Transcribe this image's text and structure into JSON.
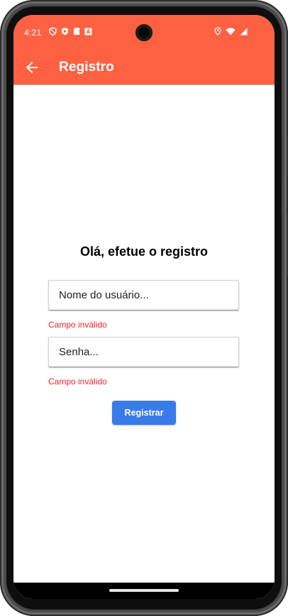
{
  "status_bar": {
    "time": "4:21",
    "left_icons": [
      "shield-outline-icon",
      "shield-dot-icon",
      "sd-card-icon",
      "text-a-icon"
    ],
    "right_icons": [
      "location-icon",
      "wifi-icon",
      "signal-icon"
    ]
  },
  "app_bar": {
    "title": "Registro",
    "back_icon": "arrow-left-icon",
    "color": "#fe6142"
  },
  "form": {
    "heading": "Olá, efetue o registro",
    "username": {
      "placeholder": "Nome do usuário...",
      "value": "",
      "error": "Campo inválido"
    },
    "password": {
      "placeholder": "Senha...",
      "value": "",
      "error": "Campo inválido"
    },
    "submit_label": "Registrar",
    "submit_color": "#3a7bea",
    "error_color": "#e5252a"
  }
}
